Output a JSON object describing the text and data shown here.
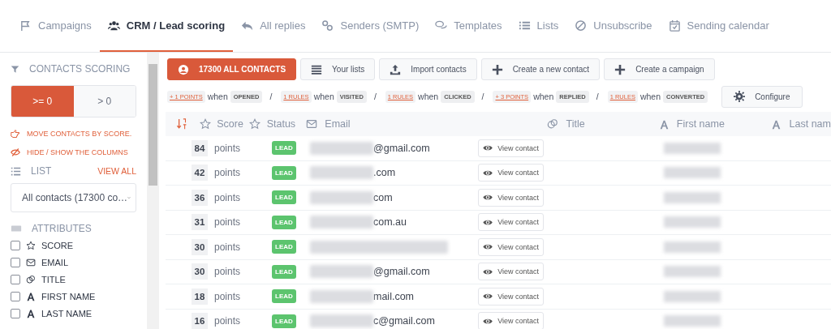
{
  "nav": {
    "tabs": [
      {
        "label": "Campaigns",
        "selected": false
      },
      {
        "label": "CRM / Lead scoring",
        "selected": true
      },
      {
        "label": "All replies",
        "selected": false
      },
      {
        "label": "Senders (SMTP)",
        "selected": false
      },
      {
        "label": "Templates",
        "selected": false
      },
      {
        "label": "Lists",
        "selected": false
      },
      {
        "label": "Unsubscribe",
        "selected": false
      },
      {
        "label": "Sending calendar",
        "selected": false
      }
    ]
  },
  "sidebar": {
    "scoring_title": "CONTACTS SCORING",
    "filters": [
      {
        "label": ">= 0",
        "selected": true
      },
      {
        "label": "> 0",
        "selected": false
      }
    ],
    "actions": [
      "MOVE CONTACTS BY SCORE.",
      "HIDE / SHOW THE COLUMNS"
    ],
    "list_title": "LIST",
    "view_all": "VIEW ALL",
    "list_select": "All contacts (17300 co…",
    "attributes_title": "ATTRIBUTES",
    "attributes": [
      {
        "label": "SCORE",
        "checked": false
      },
      {
        "label": "EMAIL",
        "checked": false
      },
      {
        "label": "TITLE",
        "checked": false
      },
      {
        "label": "FIRST NAME",
        "checked": false
      },
      {
        "label": "LAST NAME",
        "checked": false
      }
    ]
  },
  "toolbar": [
    {
      "label": "17300 ALL CONTACTS",
      "kind": "primary"
    },
    {
      "label": "Your lists",
      "kind": "default"
    },
    {
      "label": "Import contacts",
      "kind": "default"
    },
    {
      "label": "Create a new contact",
      "kind": "default"
    },
    {
      "label": "Create a campaign",
      "kind": "default"
    }
  ],
  "rules": [
    {
      "value": "+ 1 POINTS",
      "when": "when",
      "event": "OPENED"
    },
    {
      "value": "1 RULES",
      "when": "when",
      "event": "VISITED"
    },
    {
      "value": "1 RULES",
      "when": "when",
      "event": "CLICKED"
    },
    {
      "value": "+ 3 POINTS",
      "when": "when",
      "event": "REPLIED"
    },
    {
      "value": "1 RULES",
      "when": "when",
      "event": "CONVERTED"
    }
  ],
  "rule_separator": "/",
  "configure": "Configure",
  "table": {
    "columns": [
      "Score",
      "Status",
      "Email",
      "Title",
      "First name",
      "Last nam"
    ],
    "rows": [
      {
        "score": "84",
        "unit": "points",
        "status": "LEAD",
        "email": "@gmail.com",
        "action": "View contact"
      },
      {
        "score": "42",
        "unit": "points",
        "status": "LEAD",
        "email": ".com",
        "action": "View contact"
      },
      {
        "score": "36",
        "unit": "points",
        "status": "LEAD",
        "email": "com",
        "action": "View contact"
      },
      {
        "score": "31",
        "unit": "points",
        "status": "LEAD",
        "email": "com.au",
        "action": "View contact"
      },
      {
        "score": "30",
        "unit": "points",
        "status": "LEAD",
        "action": "View contact"
      },
      {
        "score": "30",
        "unit": "points",
        "status": "LEAD",
        "email": "@gmail.com",
        "action": "View contact"
      },
      {
        "score": "18",
        "unit": "points",
        "status": "LEAD",
        "email": "mail.com",
        "action": "View contact"
      },
      {
        "score": "16",
        "unit": "points",
        "status": "LEAD",
        "email": "c@gmail.com",
        "action": "View contact"
      }
    ]
  }
}
